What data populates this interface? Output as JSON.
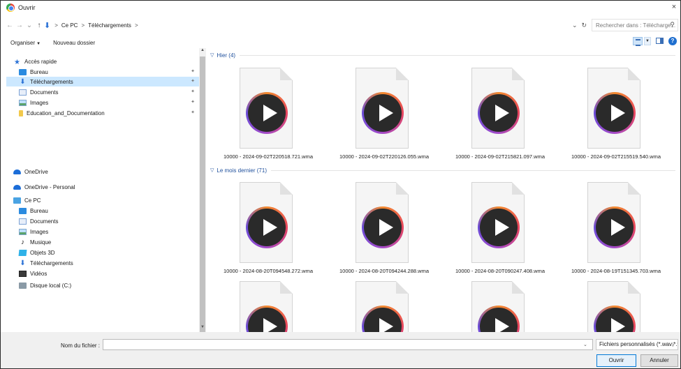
{
  "window": {
    "title": "Ouvrir",
    "close": "×"
  },
  "address": {
    "back": "←",
    "forward": "→",
    "recent": "⌄",
    "up": "↑",
    "crumbs": [
      "Ce PC",
      "Téléchargements"
    ],
    "separator": ">",
    "search_placeholder": "Rechercher dans : Télécharge..."
  },
  "toolbar": {
    "organize": "Organiser",
    "new_folder": "Nouveau dossier"
  },
  "sidebar": {
    "quick_access": "Accès rapide",
    "quick_items": [
      "Bureau",
      "Téléchargements",
      "Documents",
      "Images",
      "Education_and_Documentation"
    ],
    "onedrive": "OneDrive",
    "onedrive_personal": "OneDrive - Personal",
    "this_pc": "Ce PC",
    "pc_items": [
      "Bureau",
      "Documents",
      "Images",
      "Musique",
      "Objets 3D",
      "Téléchargements",
      "Vidéos",
      "Disque local (C:)"
    ]
  },
  "groups": [
    {
      "label": "Hier (4)",
      "files": [
        "10000 - 2024-09-02T220518.721.wma",
        "10000 - 2024-09-02T220126.055.wma",
        "10000 - 2024-09-02T215821.097.wma",
        "10000 - 2024-09-02T215519.540.wma"
      ]
    },
    {
      "label": "Le mois dernier (71)",
      "files": [
        "10000 - 2024-08-20T094548.272.wma",
        "10000 - 2024-08-20T094244.288.wma",
        "10000 - 2024-08-20T090247.408.wma",
        "10000 - 2024-08-19T151345.703.wma"
      ]
    }
  ],
  "bottom": {
    "filename_label": "Nom du fichier :",
    "filename_value": "",
    "filter": "Fichiers personnalisés (*.wav;*.w",
    "open": "Ouvrir",
    "cancel": "Annuler"
  }
}
